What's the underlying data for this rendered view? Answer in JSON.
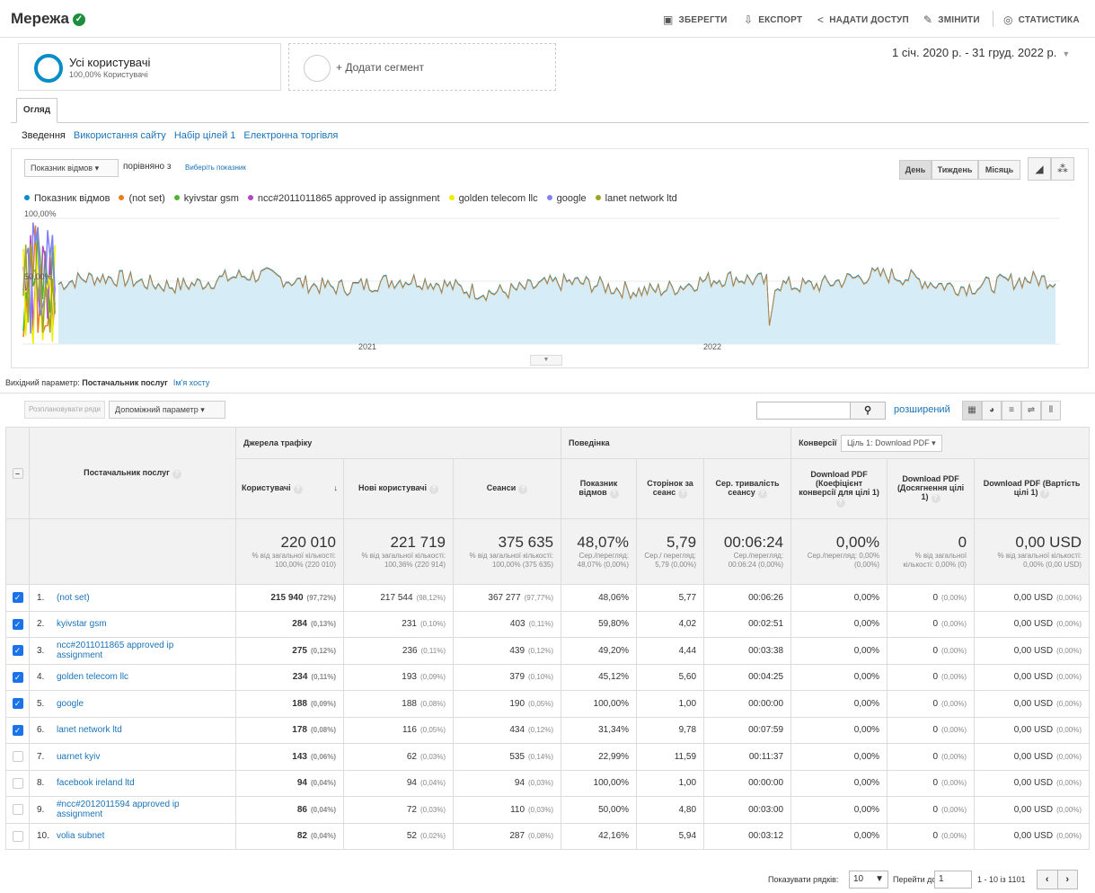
{
  "header": {
    "title": "Мережа",
    "actions": {
      "save": "ЗБЕРЕГТИ",
      "export": "ЕКСПОРТ",
      "share": "НАДАТИ ДОСТУП",
      "edit": "ЗМІНИТИ",
      "insights": "СТАТИСТИКА"
    }
  },
  "segments": {
    "active_name": "Усі користувачі",
    "active_sub": "100,00% Користувачі",
    "add_label": "+ Додати сегмент"
  },
  "date_range": "1 січ. 2020 р. - 31 груд. 2022 р.",
  "tabs": {
    "overview": "Огляд"
  },
  "subnav": [
    "Зведення",
    "Використання сайту",
    "Набір цілей 1",
    "Електронна торгівля"
  ],
  "chart_controls": {
    "metric": "Показник відмов",
    "compare_label": "порівняно з",
    "compare_link": "Виберіть показник",
    "granularity": [
      "День",
      "Тиждень",
      "Місяць"
    ]
  },
  "chart_data": {
    "type": "line",
    "y_labels": [
      "100,00%",
      "50,00%"
    ],
    "x_labels": [
      "2021",
      "2022"
    ],
    "series": [
      {
        "name": "Показник відмов",
        "color": "#058dc7"
      },
      {
        "name": "(not set)",
        "color": "#ed7e17"
      },
      {
        "name": "kyivstar gsm",
        "color": "#50b432"
      },
      {
        "name": "ncc#2011011865 approved ip assignment",
        "color": "#af49c5"
      },
      {
        "name": "golden telecom llc",
        "color": "#edef00"
      },
      {
        "name": "google",
        "color": "#8080ff"
      },
      {
        "name": "lanet network ltd",
        "color": "#a0a424"
      }
    ],
    "ylim": [
      0,
      100
    ]
  },
  "dimension": {
    "label": "Вихідний параметр:",
    "primary": "Постачальник послуг",
    "alt": "Ім'я хосту"
  },
  "table_controls": {
    "plot_rows": "Розплановувати ряди",
    "secondary_dim": "Допоміжний параметр",
    "advanced": "розширений"
  },
  "table": {
    "dim_header": "Постачальник послуг",
    "groups": {
      "acquisition": "Джерела трафіку",
      "behavior": "Поведінка",
      "conversions": "Конверсії",
      "goal_select": "Ціль 1: Download PDF"
    },
    "columns": [
      "Користувачі",
      "Нові користувачі",
      "Сеанси",
      "Показник відмов",
      "Сторінок за сеанс",
      "Сер. тривалість сеансу",
      "Download PDF (Коефіцієнт конверсії для цілі 1)",
      "Download PDF (Досягнення цілі 1)",
      "Download PDF (Вартість цілі 1)"
    ],
    "totals": [
      {
        "big": "220 010",
        "small": "% від загальної кількості: 100,00% (220 010)"
      },
      {
        "big": "221 719",
        "small": "% від загальної кількості: 100,36% (220 914)"
      },
      {
        "big": "375 635",
        "small": "% від загальної кількості: 100,00% (375 635)"
      },
      {
        "big": "48,07%",
        "small": "Сер./перегляд: 48,07% (0,00%)"
      },
      {
        "big": "5,79",
        "small": "Сер./ перегляд: 5,79 (0,00%)"
      },
      {
        "big": "00:06:24",
        "small": "Сер./перегляд: 00:06:24 (0,00%)"
      },
      {
        "big": "0,00%",
        "small": "Сер./перегляд: 0,00% (0,00%)"
      },
      {
        "big": "0",
        "small": "% від загальної кількості: 0,00% (0)"
      },
      {
        "big": "0,00 USD",
        "small": "% від загальної кількості: 0,00% (0,00 USD)"
      }
    ],
    "rows": [
      {
        "idx": "1.",
        "name": "(not set)",
        "checked": true,
        "users": "215 940",
        "users_pct": "(97,72%)",
        "new": "217 544",
        "new_pct": "(98,12%)",
        "sessions": "367 277",
        "sessions_pct": "(97,77%)",
        "bounce": "48,06%",
        "pages": "5,77",
        "dur": "00:06:26",
        "conv": "0,00%",
        "goal": "0",
        "goal_pct": "(0,00%)",
        "value": "0,00 USD",
        "value_pct": "(0,00%)"
      },
      {
        "idx": "2.",
        "name": "kyivstar gsm",
        "checked": true,
        "users": "284",
        "users_pct": "(0,13%)",
        "new": "231",
        "new_pct": "(0,10%)",
        "sessions": "403",
        "sessions_pct": "(0,11%)",
        "bounce": "59,80%",
        "pages": "4,02",
        "dur": "00:02:51",
        "conv": "0,00%",
        "goal": "0",
        "goal_pct": "(0,00%)",
        "value": "0,00 USD",
        "value_pct": "(0,00%)"
      },
      {
        "idx": "3.",
        "name": "ncc#2011011865 approved ip assignment",
        "checked": true,
        "users": "275",
        "users_pct": "(0,12%)",
        "new": "236",
        "new_pct": "(0,11%)",
        "sessions": "439",
        "sessions_pct": "(0,12%)",
        "bounce": "49,20%",
        "pages": "4,44",
        "dur": "00:03:38",
        "conv": "0,00%",
        "goal": "0",
        "goal_pct": "(0,00%)",
        "value": "0,00 USD",
        "value_pct": "(0,00%)"
      },
      {
        "idx": "4.",
        "name": "golden telecom llc",
        "checked": true,
        "users": "234",
        "users_pct": "(0,11%)",
        "new": "193",
        "new_pct": "(0,09%)",
        "sessions": "379",
        "sessions_pct": "(0,10%)",
        "bounce": "45,12%",
        "pages": "5,60",
        "dur": "00:04:25",
        "conv": "0,00%",
        "goal": "0",
        "goal_pct": "(0,00%)",
        "value": "0,00 USD",
        "value_pct": "(0,00%)"
      },
      {
        "idx": "5.",
        "name": "google",
        "checked": true,
        "users": "188",
        "users_pct": "(0,09%)",
        "new": "188",
        "new_pct": "(0,08%)",
        "sessions": "190",
        "sessions_pct": "(0,05%)",
        "bounce": "100,00%",
        "pages": "1,00",
        "dur": "00:00:00",
        "conv": "0,00%",
        "goal": "0",
        "goal_pct": "(0,00%)",
        "value": "0,00 USD",
        "value_pct": "(0,00%)"
      },
      {
        "idx": "6.",
        "name": "lanet network ltd",
        "checked": true,
        "users": "178",
        "users_pct": "(0,08%)",
        "new": "116",
        "new_pct": "(0,05%)",
        "sessions": "434",
        "sessions_pct": "(0,12%)",
        "bounce": "31,34%",
        "pages": "9,78",
        "dur": "00:07:59",
        "conv": "0,00%",
        "goal": "0",
        "goal_pct": "(0,00%)",
        "value": "0,00 USD",
        "value_pct": "(0,00%)"
      },
      {
        "idx": "7.",
        "name": "uarnet kyiv",
        "checked": false,
        "users": "143",
        "users_pct": "(0,06%)",
        "new": "62",
        "new_pct": "(0,03%)",
        "sessions": "535",
        "sessions_pct": "(0,14%)",
        "bounce": "22,99%",
        "pages": "11,59",
        "dur": "00:11:37",
        "conv": "0,00%",
        "goal": "0",
        "goal_pct": "(0,00%)",
        "value": "0,00 USD",
        "value_pct": "(0,00%)"
      },
      {
        "idx": "8.",
        "name": "facebook ireland ltd",
        "checked": false,
        "users": "94",
        "users_pct": "(0,04%)",
        "new": "94",
        "new_pct": "(0,04%)",
        "sessions": "94",
        "sessions_pct": "(0,03%)",
        "bounce": "100,00%",
        "pages": "1,00",
        "dur": "00:00:00",
        "conv": "0,00%",
        "goal": "0",
        "goal_pct": "(0,00%)",
        "value": "0,00 USD",
        "value_pct": "(0,00%)"
      },
      {
        "idx": "9.",
        "name": "#ncc#2012011594 approved ip assignment",
        "checked": false,
        "users": "86",
        "users_pct": "(0,04%)",
        "new": "72",
        "new_pct": "(0,03%)",
        "sessions": "110",
        "sessions_pct": "(0,03%)",
        "bounce": "50,00%",
        "pages": "4,80",
        "dur": "00:03:00",
        "conv": "0,00%",
        "goal": "0",
        "goal_pct": "(0,00%)",
        "value": "0,00 USD",
        "value_pct": "(0,00%)"
      },
      {
        "idx": "10.",
        "name": "volia subnet",
        "checked": false,
        "users": "82",
        "users_pct": "(0,04%)",
        "new": "52",
        "new_pct": "(0,02%)",
        "sessions": "287",
        "sessions_pct": "(0,08%)",
        "bounce": "42,16%",
        "pages": "5,94",
        "dur": "00:03:12",
        "conv": "0,00%",
        "goal": "0",
        "goal_pct": "(0,00%)",
        "value": "0,00 USD",
        "value_pct": "(0,00%)"
      }
    ]
  },
  "footer": {
    "rows_label": "Показувати рядків:",
    "rows_value": "10",
    "goto_label": "Перейти до:",
    "goto_value": "1",
    "range": "1 - 10 із 1101"
  }
}
